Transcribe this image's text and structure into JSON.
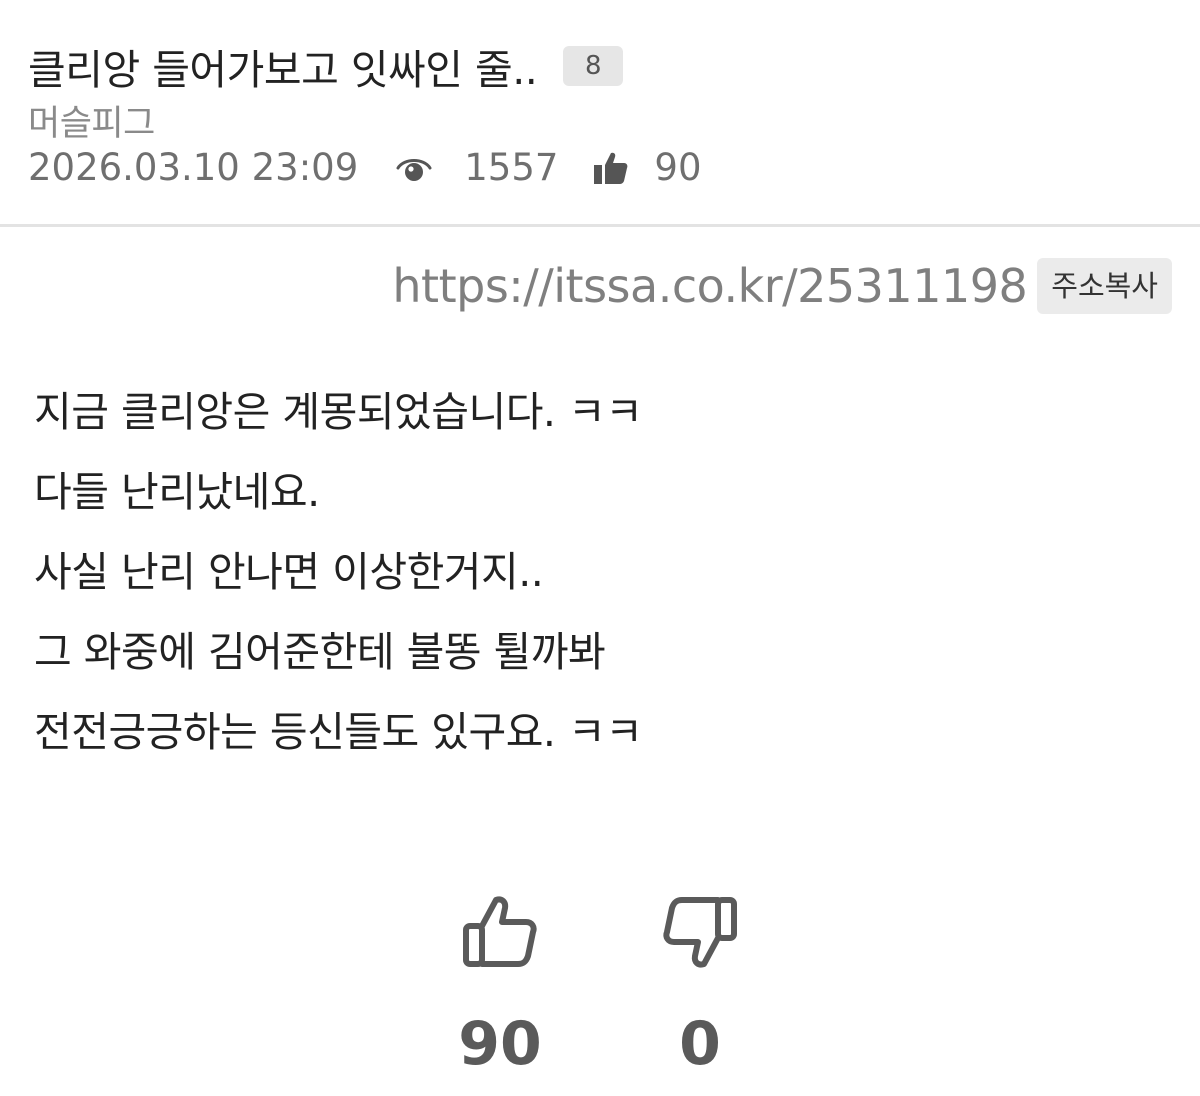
{
  "post": {
    "title": "클리앙 들어가보고 잇싸인 줄..",
    "comment_count": "8",
    "author": "머슬피그",
    "datetime": "2026.03.10 23:09",
    "views": "1557",
    "likes": "90"
  },
  "link": {
    "url": "https://itssa.co.kr/25311198",
    "copy_label": "주소복사"
  },
  "body": {
    "lines": [
      "지금 클리앙은 계몽되었습니다.  ㅋㅋ",
      "다들 난리났네요.",
      "사실 난리 안나면 이상한거지..",
      "그 와중에 김어준한테 불똥 튈까봐",
      "전전긍긍하는 등신들도 있구요.  ㅋㅋ"
    ]
  },
  "votes": {
    "up_count": "90",
    "down_count": "0"
  },
  "icons": {
    "views": "eye-icon",
    "likes": "thumbs-up-filled-icon",
    "upvote": "thumbs-up-outline-icon",
    "downvote": "thumbs-down-outline-icon"
  },
  "colors": {
    "divider": "#e3e3e3",
    "badge_bg": "#e6e6e6",
    "muted_text": "#8a8a8a",
    "vote_icon": "#5a5a5a"
  }
}
